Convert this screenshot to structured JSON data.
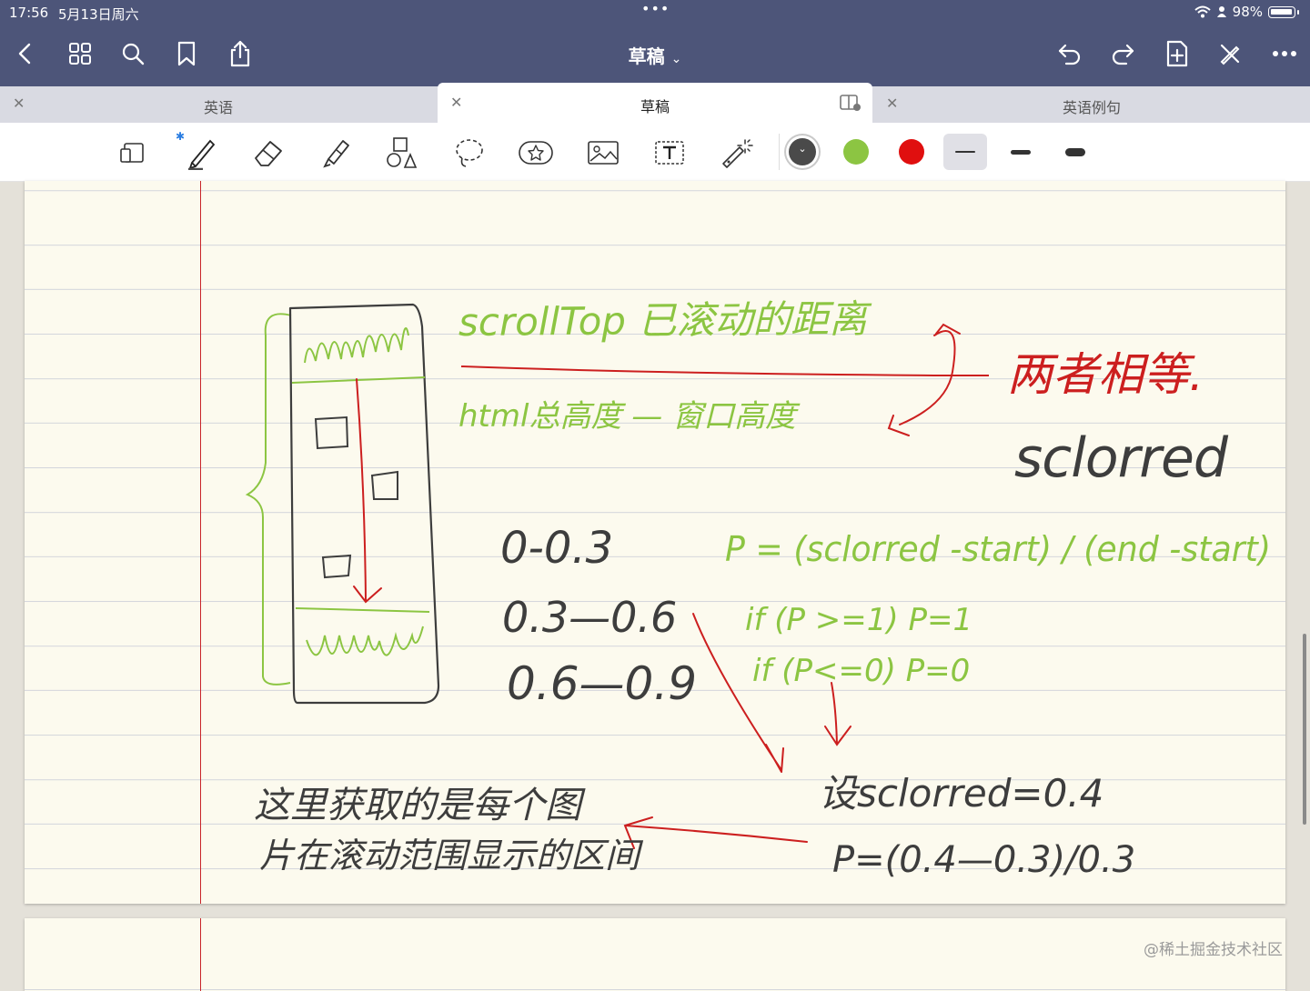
{
  "status_bar": {
    "time": "17:56",
    "date": "5月13日周六",
    "battery": "98%"
  },
  "nav": {
    "title": "草稿"
  },
  "tabs": [
    {
      "label": "英语"
    },
    {
      "label": "草稿"
    },
    {
      "label": "英语例句"
    }
  ],
  "toolbar": {
    "colors": {
      "dark": "#4a4a4a",
      "green": "#8cc542",
      "red": "#e00f0f"
    },
    "bluetooth": "✱"
  },
  "notes": {
    "green_line1": "scrollTop 已滚动的距离",
    "green_line2": "html总高度 — 窗口高度",
    "red_conclusion": "两者相等.",
    "var_name": "sclorred",
    "range1": "0-0.3",
    "range2": "0.3—0.6",
    "range3": "0.6—0.9",
    "formula": "P = (sclorred -start) / (end -start)",
    "cond1": "if (P >=1) P=1",
    "cond2": "if (P<=0) P=0",
    "assume": "设sclorred=0.4",
    "calc": "P=(0.4—0.3)/0.3",
    "explain1": "这里获取的是每个图",
    "explain2": "片在滚动范围显示的区间"
  },
  "watermark": "@稀土掘金技术社区"
}
